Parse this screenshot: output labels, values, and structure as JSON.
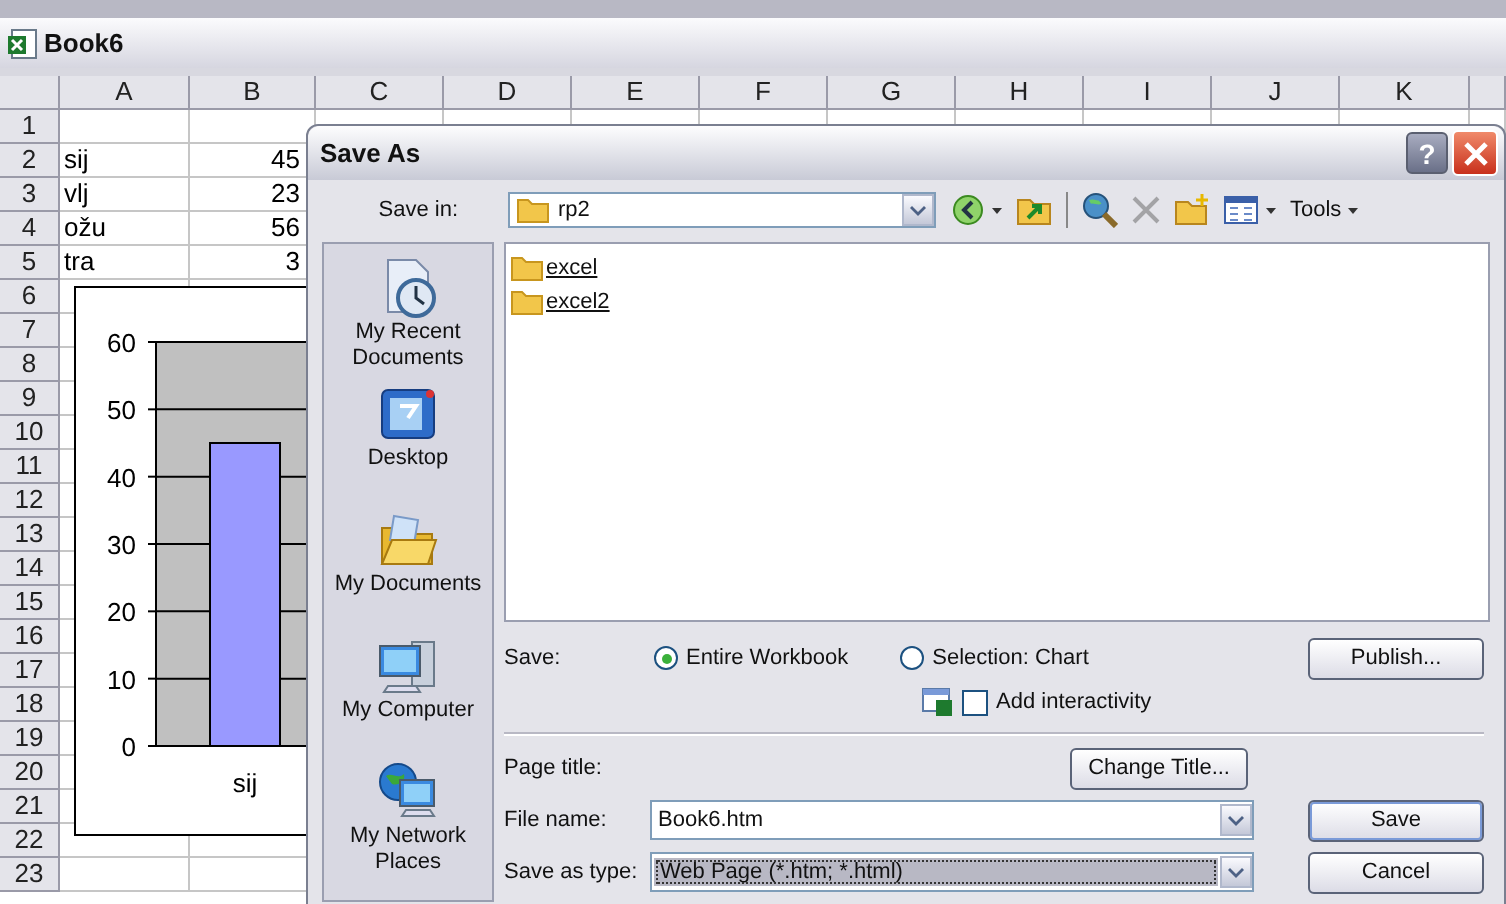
{
  "window": {
    "title": "Book6"
  },
  "sheet": {
    "columns": [
      "A",
      "B",
      "C",
      "D",
      "E",
      "F",
      "G",
      "H",
      "I",
      "J",
      "K"
    ],
    "rows": [
      {
        "number": "1"
      },
      {
        "number": "2",
        "label": "sij",
        "value": "45"
      },
      {
        "number": "3",
        "label": "vlj",
        "value": "23"
      },
      {
        "number": "4",
        "label": "ožu",
        "value": "56"
      },
      {
        "number": "5",
        "label": "tra",
        "value": "3"
      },
      {
        "number": "6"
      },
      {
        "number": "7"
      },
      {
        "number": "8"
      },
      {
        "number": "9"
      },
      {
        "number": "10"
      },
      {
        "number": "11"
      },
      {
        "number": "12"
      },
      {
        "number": "13"
      },
      {
        "number": "14"
      },
      {
        "number": "15"
      },
      {
        "number": "16"
      },
      {
        "number": "17"
      },
      {
        "number": "18"
      },
      {
        "number": "19"
      },
      {
        "number": "20"
      },
      {
        "number": "21"
      },
      {
        "number": "22"
      },
      {
        "number": "23"
      }
    ]
  },
  "chart": {
    "chart_data": {
      "type": "bar",
      "categories": [
        "sij"
      ],
      "values": [
        45
      ],
      "ylim": [
        0,
        60
      ],
      "yticks": [
        0,
        10,
        20,
        30,
        40,
        50,
        60
      ],
      "grid": true
    }
  },
  "dialog": {
    "title": "Save As",
    "help": "?",
    "save_in": {
      "label": "Save in:",
      "value": "rp2"
    },
    "toolbar": {
      "navigation": [
        {
          "kind": "back",
          "dropdown": true,
          "disabled": false
        },
        {
          "kind": "up",
          "dropdown": false,
          "disabled": false
        }
      ],
      "tools": [
        {
          "kind": "search",
          "dropdown": false,
          "disabled": false
        },
        {
          "kind": "delete",
          "dropdown": false,
          "disabled": true
        },
        {
          "kind": "new-folder",
          "dropdown": false,
          "disabled": false
        },
        {
          "kind": "views",
          "dropdown": true,
          "disabled": false
        }
      ],
      "tools_menu": "Tools"
    },
    "places": [
      {
        "kind": "recent",
        "label": "My Recent Documents"
      },
      {
        "kind": "desktop",
        "label": "Desktop"
      },
      {
        "kind": "documents",
        "label": "My Documents"
      },
      {
        "kind": "computer",
        "label": "My Computer"
      },
      {
        "kind": "network",
        "label": "My Network Places"
      }
    ],
    "files": [
      {
        "name": "excel"
      },
      {
        "name": "excel2"
      }
    ],
    "save_options": {
      "label": "Save:",
      "options": [
        {
          "label": "Entire Workbook",
          "selected": true
        },
        {
          "label": "Selection: Chart",
          "selected": false
        }
      ]
    },
    "interactivity": {
      "label": "Add interactivity",
      "checked": false
    },
    "publish_button": "Publish...",
    "page_title": {
      "label": "Page title:",
      "button": "Change Title..."
    },
    "file_name": {
      "label": "File name:",
      "value": "Book6.htm"
    },
    "save_as_type": {
      "label": "Save as type:",
      "value": "Web Page (*.htm; *.html)",
      "focused": true
    },
    "buttons": [
      {
        "label": "Save",
        "default": true
      },
      {
        "label": "Cancel",
        "default": false
      }
    ]
  }
}
